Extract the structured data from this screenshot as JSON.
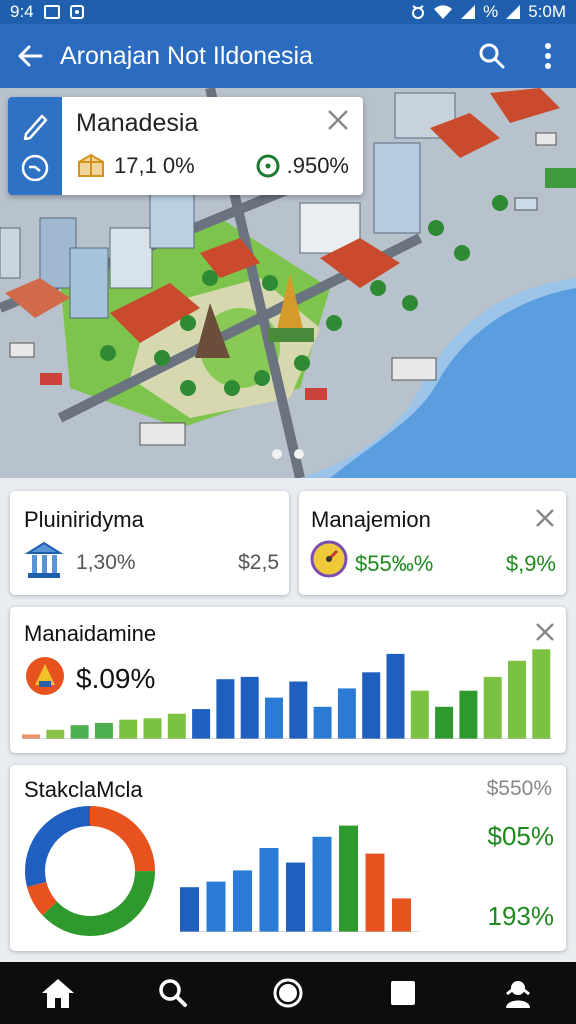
{
  "status_bar": {
    "time_left": "9:4",
    "battery": "%",
    "time_right": "5:0M"
  },
  "app_bar": {
    "title": "Aronajan Not Ildonesia"
  },
  "icons": {
    "back": "arrow-left-icon",
    "search": "search-icon",
    "more": "more-vertical-icon",
    "edit": "pencil-icon",
    "clock": "clock-icon",
    "box": "box-icon",
    "gauge": "gauge-icon",
    "bank": "bank-icon",
    "dial": "dial-icon",
    "temple": "temple-icon",
    "nav": [
      "home-icon",
      "search-icon",
      "circle-icon",
      "square-icon",
      "person-icon"
    ]
  },
  "info_card": {
    "title": "Manadesia",
    "stat1": "17,1 0%",
    "stat2": ".950%"
  },
  "carousel": {
    "pages": 2
  },
  "stat_card_1": {
    "title": "Pluiniridyma",
    "value": "1,30%",
    "amount": "$2,5"
  },
  "stat_card_2": {
    "title": "Manajemion",
    "value": "$55‰%",
    "amount": "$,9%"
  },
  "bar_card": {
    "title": "Manaidamine",
    "value": "$.09%"
  },
  "donut_card": {
    "title": "StakclaMcla",
    "top_value": "$550%",
    "value_1": "$05%",
    "value_2": "193%"
  },
  "colors": {
    "primary": "#2b6bc0",
    "blue": "#1f5fc0",
    "green": "#1e8a1e",
    "orange": "#e8521e"
  },
  "chart_data": [
    {
      "type": "bar",
      "title": "Manaidamine",
      "values": [
        1,
        2,
        3,
        3.5,
        4.2,
        4.5,
        5.5,
        6.5,
        13,
        13.5,
        9,
        12.5,
        7,
        11,
        14.5,
        18.5,
        10.5,
        7,
        10.5,
        13.5,
        17,
        19.5
      ],
      "colors": [
        "#e8956b",
        "#8bc34a",
        "#4caf50",
        "#4caf50",
        "#7cc242",
        "#7cc242",
        "#7cc242",
        "#1f5fc0",
        "#1f5fc0",
        "#1f5fc0",
        "#2a7bd6",
        "#1f5fc0",
        "#2a7bd6",
        "#2a7bd6",
        "#1f5fc0",
        "#1f5fc0",
        "#7cc242",
        "#2e9a2e",
        "#2e9a2e",
        "#7cc242",
        "#7cc242",
        "#7cc242"
      ],
      "ylim": [
        0,
        20
      ]
    },
    {
      "type": "pie",
      "title": "StakclaMcla",
      "slices": [
        {
          "value": 25,
          "color": "#e8521e"
        },
        {
          "value": 38,
          "color": "#2e9a2e"
        },
        {
          "value": 8,
          "color": "#e8521e"
        },
        {
          "value": 29,
          "color": "#1f5fc0"
        }
      ]
    },
    {
      "type": "bar",
      "values": [
        4,
        4.5,
        5.5,
        7.5,
        6.2,
        8.5,
        9.5,
        7,
        3
      ],
      "colors": [
        "#1f5fc0",
        "#2a7bd6",
        "#2a7bd6",
        "#2a7bd6",
        "#1f5fc0",
        "#2a7bd6",
        "#2e9a2e",
        "#e8521e",
        "#e8521e"
      ],
      "ylim": [
        0,
        10
      ]
    }
  ]
}
